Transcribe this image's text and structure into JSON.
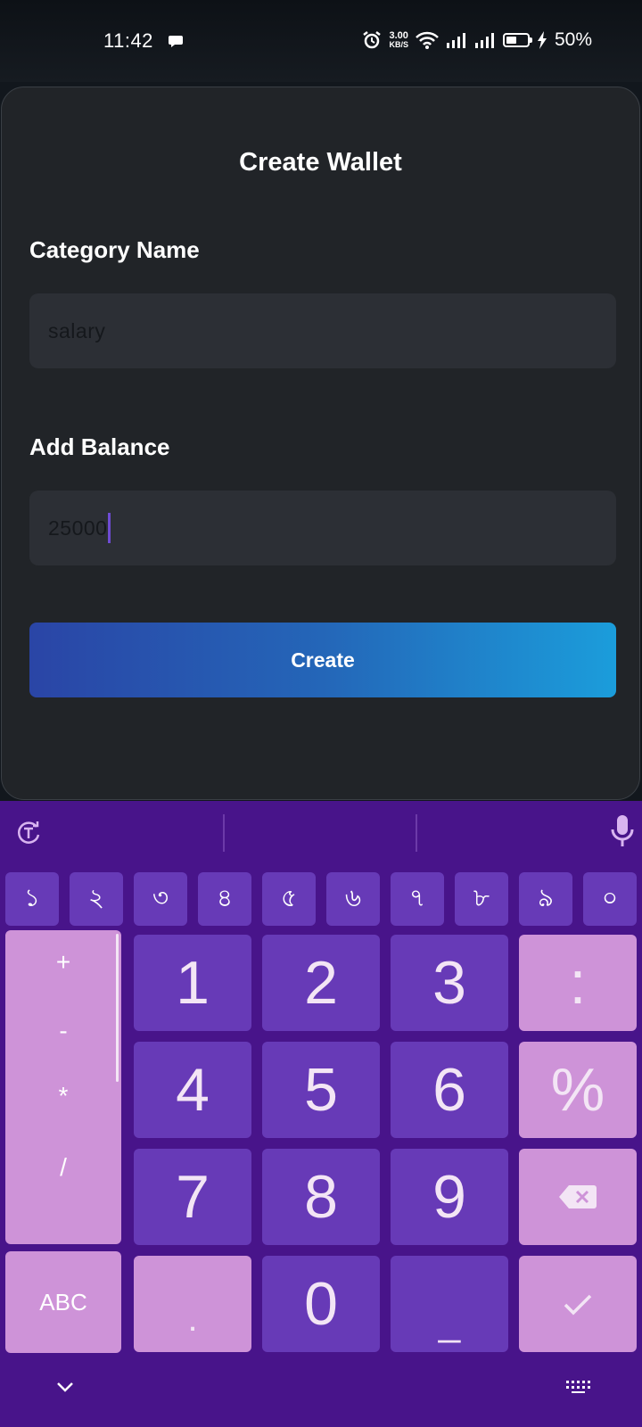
{
  "status_bar": {
    "time": "11:42",
    "speed_value": "3.00",
    "speed_unit": "KB/S",
    "battery": "50%",
    "icons": [
      "chat-icon",
      "alarm-icon",
      "wifi-icon",
      "signal-icon",
      "signal-icon",
      "battery-icon",
      "charging-icon"
    ]
  },
  "sheet": {
    "title": "Create Wallet",
    "category_label": "Category Name",
    "category_placeholder": "salary",
    "balance_label": "Add Balance",
    "balance_value": "25000",
    "create_label": "Create"
  },
  "keyboard": {
    "digit_row": [
      "১",
      "২",
      "৩",
      "৪",
      "৫",
      "৬",
      "৭",
      "৮",
      "৯",
      "০"
    ],
    "operators": [
      "+",
      "-",
      "*",
      "/"
    ],
    "keys": {
      "k1": "1",
      "k2": "2",
      "k3": "3",
      "colon": ":",
      "k4": "4",
      "k5": "5",
      "k6": "6",
      "percent": "%",
      "k7": "7",
      "k8": "8",
      "k9": "9",
      "dot": ".",
      "k0": "0",
      "space": "_"
    },
    "abc": "ABC"
  },
  "colors": {
    "sheet_bg": "#212428",
    "field_bg": "#2c2f35",
    "keyboard_bg": "#48148a",
    "key_purple": "#673ab7",
    "key_pink": "#ce93d8",
    "button_gradient_start": "#2a45a6",
    "button_gradient_end": "#1b9ddb"
  }
}
